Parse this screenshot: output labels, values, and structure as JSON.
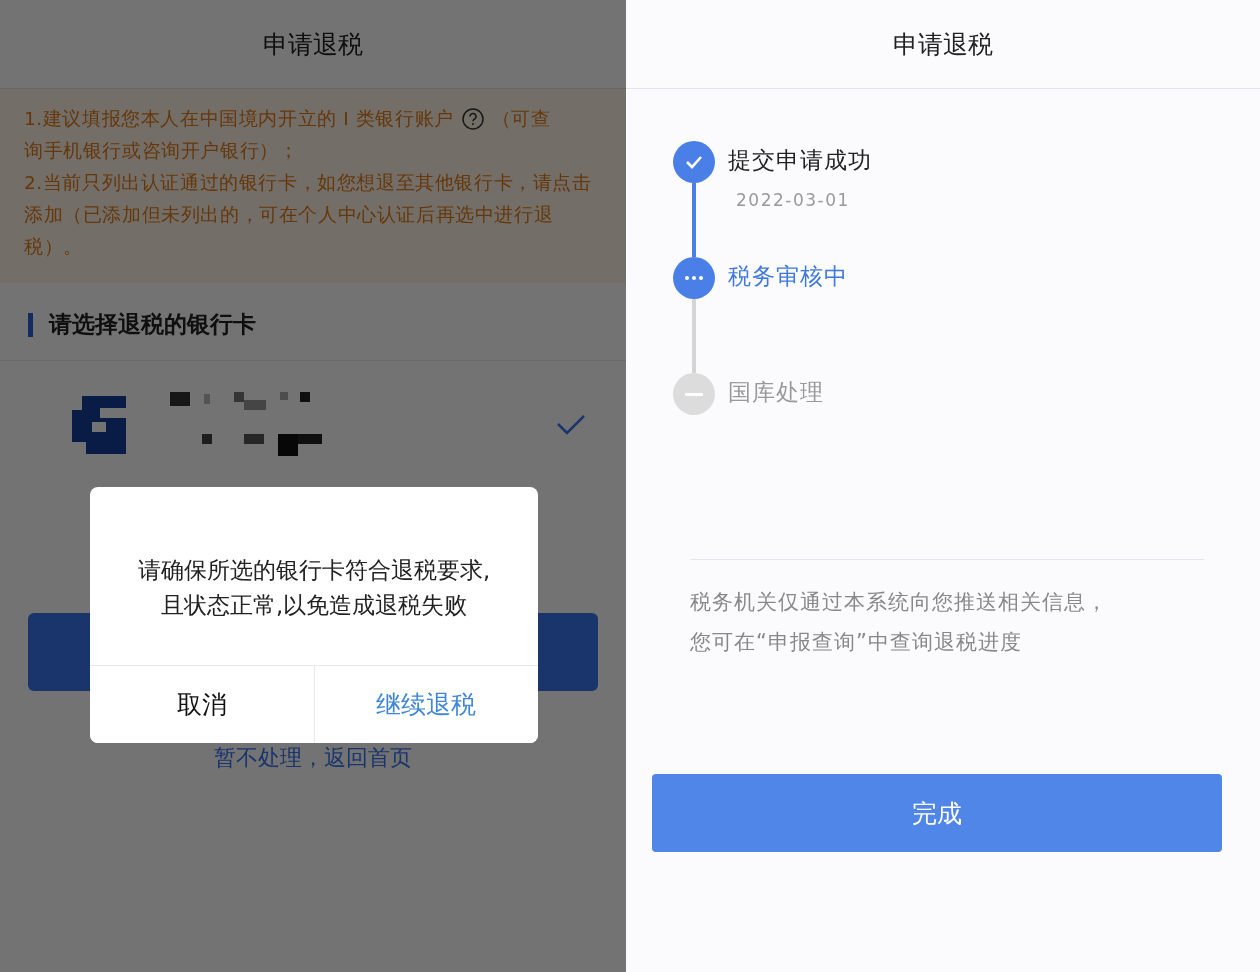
{
  "left_screen": {
    "title": "申请退税",
    "notice": {
      "item_1_before_icon": "1.建议填报您本人在中国境内开立的 I 类银行账户",
      "item_1_after_icon": "（可查",
      "item_1_line_2": "询手机银行或咨询开户银行）；",
      "item_2": "2.当前只列出认证通过的银行卡，如您想退至其他银行卡，请点击添加（已添加但未列出的，可在个人中心认证后再选中进行退税）。"
    },
    "section_title": "请选择退税的银行卡",
    "card": {
      "selected": true
    },
    "link": "暂不处理，返回首页",
    "dialog": {
      "message": "请确保所选的银行卡符合退税要求,且状态正常,以免造成退税失败",
      "buttons": [
        {
          "label": "取消",
          "kind": "cancel"
        },
        {
          "label": "继续退税",
          "kind": "confirm"
        }
      ]
    }
  },
  "right_screen": {
    "title": "申请退税",
    "steps": [
      {
        "label": "提交申请成功",
        "date": "2022-03-01",
        "kind": "done"
      },
      {
        "label": "税务审核中",
        "kind": "active"
      },
      {
        "label": "国库处理",
        "kind": "pending"
      }
    ],
    "info": [
      "税务机关仅通过本系统向您推送相关信息，",
      "您可在“申报查询”中查询退税进度"
    ],
    "button": "完成"
  }
}
